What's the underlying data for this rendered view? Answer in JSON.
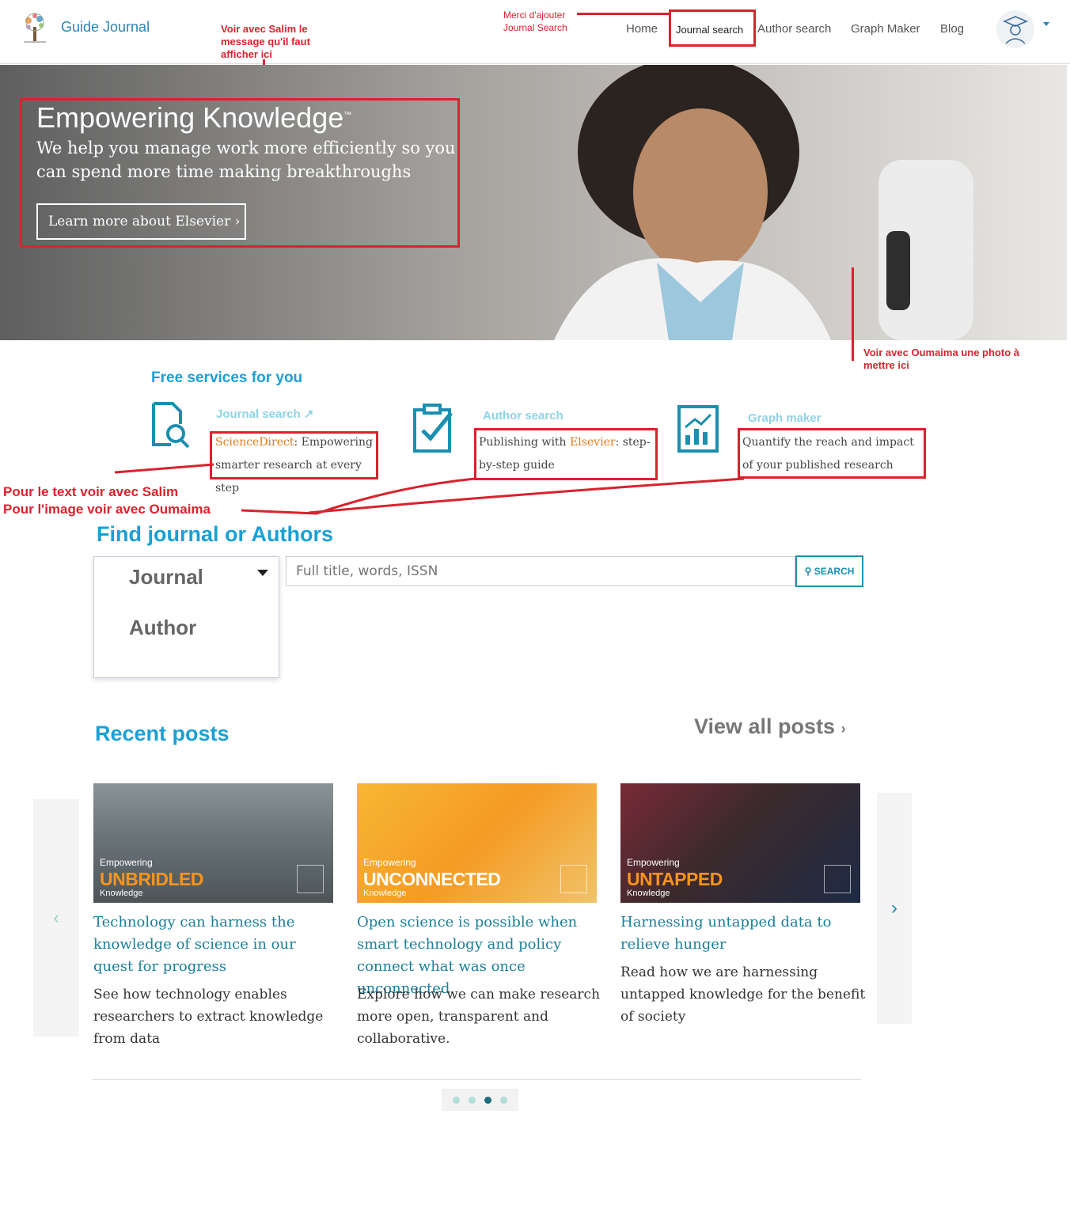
{
  "header": {
    "logo_text": "Guide Journal",
    "nav": [
      "Home",
      "Journal search",
      "Author search",
      "Graph Maker",
      "Blog"
    ]
  },
  "annotations": {
    "salim_message": "Voir avec Salim le message qu'il faut afficher ici",
    "add_journal": "Merci d'ajouter Journal Search",
    "photo": "Voir avec Oumaima une photo à mettre ici",
    "text_salim": "Pour le text voir avec Salim",
    "image_oumaima": "Pour l'image voir avec Oumaima"
  },
  "hero": {
    "title": "Empowering Knowledge",
    "tm": "™",
    "subtitle": "We help you manage work more efficiently so you can spend more time making breakthroughs",
    "button": "Learn more about Elsevier"
  },
  "services": {
    "heading": "Free services for you",
    "items": [
      {
        "title": "Journal search",
        "pre": "",
        "highlight": "ScienceDirect",
        "post": ": Empowering smarter research at every step"
      },
      {
        "title": "Author search",
        "pre": "Publishing with ",
        "highlight": "Elsevier",
        "post": ": step-by-step guide"
      },
      {
        "title": "Graph maker",
        "pre": "",
        "highlight": "",
        "post": "Quantify the reach and impact of your published research"
      }
    ]
  },
  "find": {
    "heading": "Find journal or Authors",
    "options": [
      "Journal",
      "Author"
    ],
    "placeholder": "Full title, words, ISSN",
    "search_label": "SEARCH"
  },
  "posts": {
    "heading": "Recent posts",
    "view_all": "View all posts",
    "cards": [
      {
        "overlay_top": "Empowering",
        "overlay_main": "UNBRIDLED",
        "overlay_bottom": "Knowledge",
        "title": "Technology can harness the knowledge of science in our quest for progress",
        "desc": "See how technology enables researchers to extract knowledge from data"
      },
      {
        "overlay_top": "Empowering",
        "overlay_main": "UNCONNECTED",
        "overlay_bottom": "Knowledge",
        "title": "Open science is possible when smart technology and policy connect what was once unconnected.",
        "desc": "Explore how we can make research more open, transparent and collaborative."
      },
      {
        "overlay_top": "Empowering",
        "overlay_main": "UNTAPPED",
        "overlay_bottom": "Knowledge",
        "title": "Harnessing untapped data to relieve hunger",
        "desc": "Read how we are harnessing untapped knowledge for the benefit of society"
      }
    ]
  },
  "colors": {
    "accent": "#1aa0d6",
    "annotation": "#d9232d",
    "highlight": "#e07b22"
  },
  "carousel": {
    "active_dot": 3,
    "dot_count": 4
  }
}
